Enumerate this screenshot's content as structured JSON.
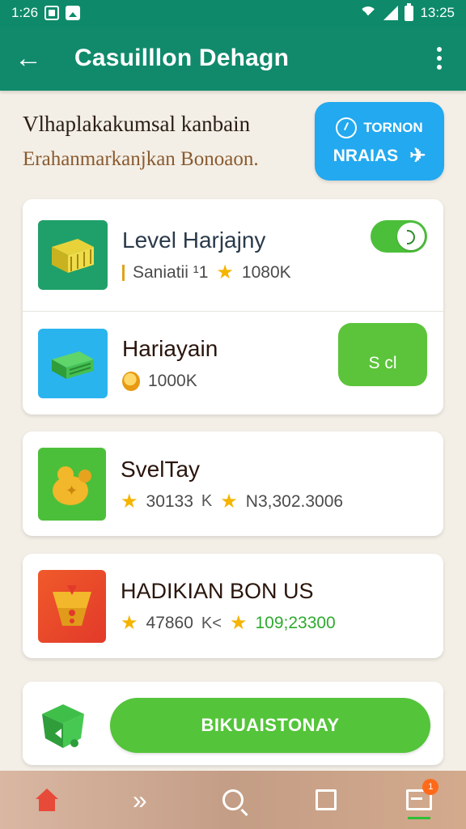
{
  "status_bar": {
    "time_left": "1:26",
    "time_right": "13:25",
    "icons": [
      "notification-box-icon",
      "photo-icon",
      "wifi-icon",
      "signal-icon",
      "battery-icon"
    ]
  },
  "app_bar": {
    "title": "Casuilllon Dehagn",
    "back_icon": "back-arrow-icon",
    "menu_icon": "more-vert-icon"
  },
  "promo": {
    "line1": "Vlhaplakakumsal kanbain",
    "line2": "Erahanmarkanjkan Bonoaon.",
    "button_top": "TORNON",
    "button_bottom": "NRAIAS",
    "colors": {
      "button": "#22a9f0"
    }
  },
  "items": [
    {
      "title": "Level Harjajny",
      "meta_label": "Saniatii ¹1",
      "meta_value": "1080K",
      "control": "toggle",
      "toggle_on": true
    },
    {
      "title": "Hariayain",
      "meta_value": "1000K",
      "button_label": "S cl"
    },
    {
      "title": "SvelTay",
      "meta_value1": "30133",
      "meta_sep": "K",
      "meta_value2": "N3,302.3006"
    },
    {
      "title": "HADIKIAN BON US",
      "meta_value1": "47860",
      "meta_sep": "K<",
      "meta_value2": "109;23300"
    }
  ],
  "cta": {
    "label": "BIKUAISTONAY",
    "color": "#54c43a"
  },
  "bottom_nav": {
    "items": [
      "home-icon",
      "forward-icon",
      "search-icon",
      "square-icon",
      "inbox-icon"
    ],
    "badge": "1"
  },
  "theme": {
    "primary": "#118a6c",
    "accent_green": "#4cbf3a",
    "star": "#f5b400"
  }
}
